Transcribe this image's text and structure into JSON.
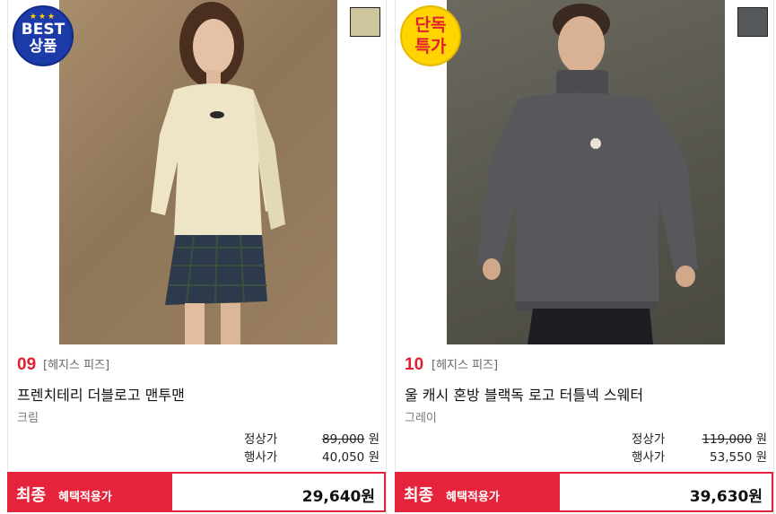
{
  "products": [
    {
      "rank": "09",
      "brand": "[헤지스 피즈]",
      "name": "프렌치테리 더블로고 맨투맨",
      "color_name": "크림",
      "swatch_color": "#cfc59c",
      "badge": {
        "type": "best",
        "stars": "★★★",
        "line1": "BEST",
        "line2": "상품"
      },
      "regular_label": "정상가",
      "regular_price": "89,000",
      "sale_label": "행사가",
      "sale_price": "40,050",
      "currency": "원",
      "final_label": "최종",
      "final_sublabel": "혜택적용가",
      "final_price": "29,640원"
    },
    {
      "rank": "10",
      "brand": "[헤지스 피즈]",
      "name": "울 캐시 혼방 블랙독 로고 터틀넥 스웨터",
      "color_name": "그레이",
      "swatch_color": "#55585b",
      "badge": {
        "type": "deal",
        "line1": "단독",
        "line2": "특가"
      },
      "regular_label": "정상가",
      "regular_price": "119,000",
      "sale_label": "행사가",
      "sale_price": "53,550",
      "currency": "원",
      "final_label": "최종",
      "final_sublabel": "혜택적용가",
      "final_price": "39,630원"
    }
  ],
  "colors": {
    "accent": "#e5243b",
    "rank": "#e0202f",
    "badge_best": "#1d3ba8",
    "badge_deal": "#ffd400"
  }
}
